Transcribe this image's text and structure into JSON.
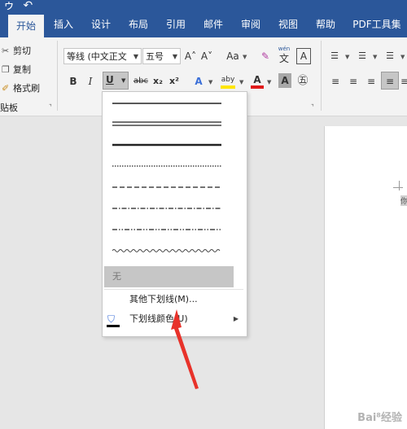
{
  "quick_access": "ゥ ↶",
  "tabs": [
    {
      "label": "开始",
      "active": true
    },
    {
      "label": "插入"
    },
    {
      "label": "设计"
    },
    {
      "label": "布局"
    },
    {
      "label": "引用"
    },
    {
      "label": "邮件"
    },
    {
      "label": "审阅"
    },
    {
      "label": "视图"
    },
    {
      "label": "帮助"
    },
    {
      "label": "PDF工具集"
    }
  ],
  "clipboard": {
    "cut": "剪切",
    "copy": "复制",
    "format_painter": "格式刷",
    "group_label": "贴板"
  },
  "font": {
    "name": "等线 (中文正文",
    "size": "五号",
    "grow": "A˄",
    "shrink": "A˅",
    "case": "Aa",
    "clear": "✎",
    "phonetic_top": "wén",
    "phonetic_bottom": "文",
    "border_char": "A",
    "bold": "B",
    "italic": "I",
    "underline": "U",
    "strike": "abc",
    "sub": "x₂",
    "sup": "x²",
    "effects": "A",
    "highlight": "aby",
    "color": "A",
    "shade": "A",
    "enclose": "㊄",
    "highlight_color": "#ffe600",
    "font_color": "#e01a1a"
  },
  "underline_menu": {
    "none": "无",
    "more": "其他下划线(M)...",
    "color": "下划线颜色(U)"
  },
  "document": {
    "visible_text": "你"
  },
  "watermark": "Bai⁸经验"
}
